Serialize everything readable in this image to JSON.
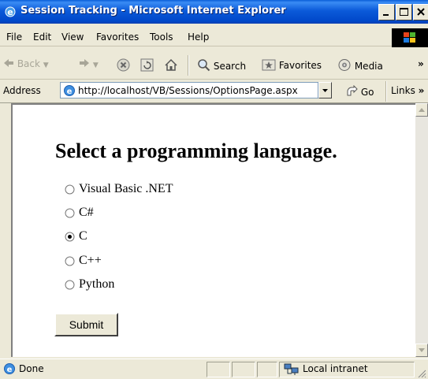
{
  "window": {
    "title": "Session Tracking - Microsoft Internet Explorer"
  },
  "menu": [
    "File",
    "Edit",
    "View",
    "Favorites",
    "Tools",
    "Help"
  ],
  "toolbar": {
    "back": "Back",
    "search": "Search",
    "favorites": "Favorites",
    "media": "Media",
    "overflow": "»"
  },
  "address": {
    "label": "Address",
    "url": "http://localhost/VB/Sessions/OptionsPage.aspx",
    "go": "Go",
    "links": "Links"
  },
  "page": {
    "heading": "Select a programming language.",
    "options": [
      {
        "label": "Visual Basic .NET",
        "checked": false
      },
      {
        "label": "C#",
        "checked": false
      },
      {
        "label": "C",
        "checked": true
      },
      {
        "label": "C++",
        "checked": false
      },
      {
        "label": "Python",
        "checked": false
      }
    ],
    "submit": "Submit"
  },
  "status": {
    "text": "Done",
    "zone": "Local intranet"
  }
}
